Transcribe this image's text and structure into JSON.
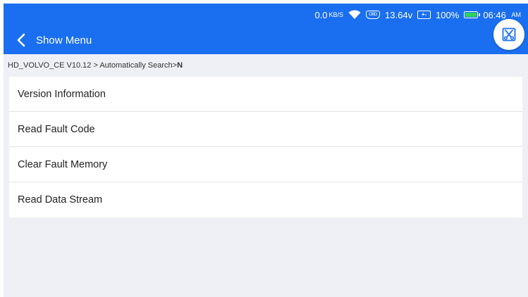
{
  "status_bar": {
    "net_speed": "0.0",
    "net_unit": "KB/S",
    "obd_icon_text": "OBD",
    "voltage": "13.64v",
    "voltage_icon_text": "+-",
    "battery": "100%",
    "time": "06:46",
    "ampm": "AM"
  },
  "header": {
    "title": "Show Menu"
  },
  "breadcrumb": {
    "path": "HD_VOLVO_CE V10.12 > Automatically Search>",
    "current": "N"
  },
  "menu": {
    "items": [
      {
        "label": "Version Information"
      },
      {
        "label": "Read Fault Code"
      },
      {
        "label": "Clear Fault Memory"
      },
      {
        "label": "Read Data Stream"
      }
    ]
  },
  "colors": {
    "primary": "#1a6ff1",
    "background": "#eff0f5",
    "battery": "#2ed35a"
  }
}
